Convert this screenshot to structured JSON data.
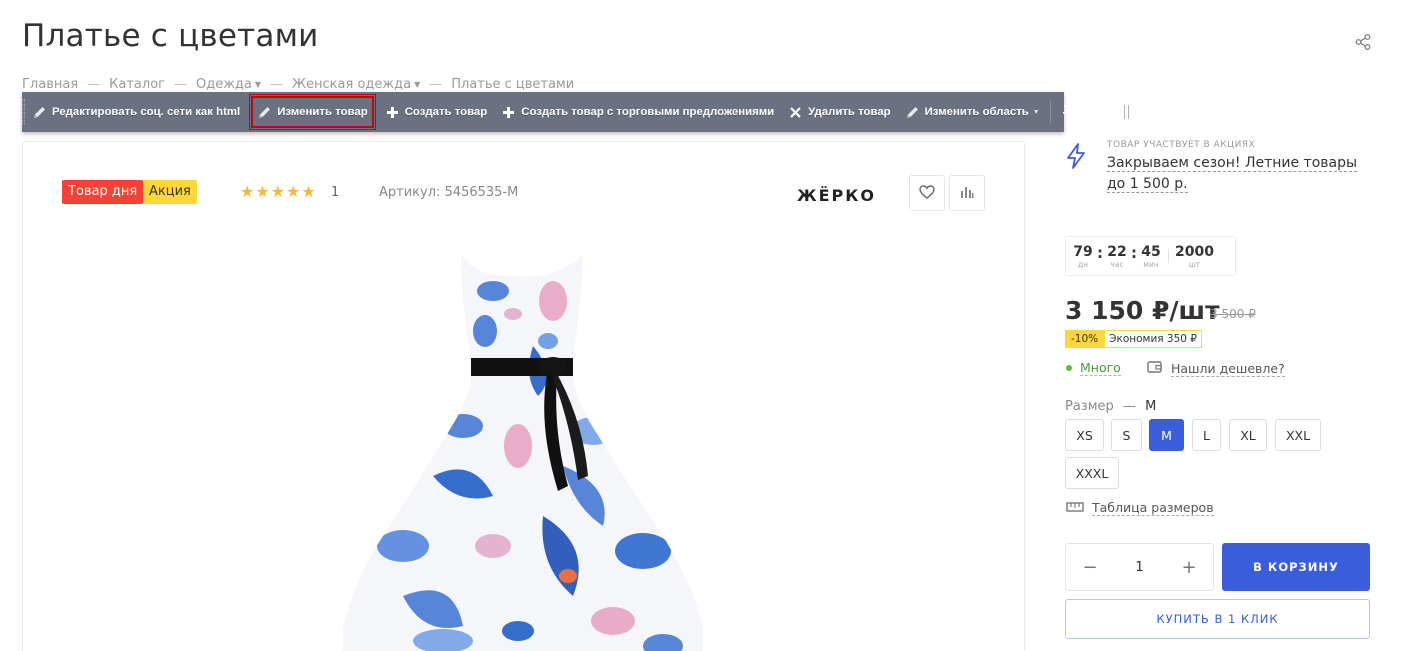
{
  "page": {
    "title": "Платье с цветами"
  },
  "breadcrumb": [
    "Главная",
    "Каталог",
    "Одежда",
    "Женская одежда",
    "Платье с цветами"
  ],
  "admin_toolbar": {
    "items": [
      {
        "label": "Редактировать соц. сети как html",
        "icon": "pencil-icon"
      },
      {
        "label": "Изменить товар",
        "icon": "pencil-icon",
        "highlighted": true
      },
      {
        "label": "Создать товар",
        "icon": "plus-icon"
      },
      {
        "label": "Создать товар с торговыми предложениями",
        "icon": "plus-icon"
      },
      {
        "label": "Удалить товар",
        "icon": "close-icon"
      },
      {
        "label": "Изменить область",
        "icon": "pencil-icon",
        "dropdown": true
      }
    ]
  },
  "product": {
    "badges": [
      "Товар дня",
      "Акция"
    ],
    "rating_stars": "★★★★★",
    "rating_count": "1",
    "sku": "Артикул: 5456535-M",
    "brand": "ЖЁРКО"
  },
  "promo": {
    "caption": "Товар участвует в акциях",
    "link": "Закрываем сезон! Летние товары до 1 500 р."
  },
  "timer": {
    "days": "79",
    "days_unit": "дн",
    "hours": "22",
    "hours_unit": "час",
    "minutes": "45",
    "minutes_unit": "мин",
    "quantity": "2000",
    "quantity_unit": "шт"
  },
  "price": {
    "current": "3 150 ₽/шт",
    "old": "3 500 ₽",
    "discount_pct": "-10%",
    "economy": "Экономия 350 ₽"
  },
  "stock": {
    "status": "Много",
    "cheaper_link": "Нашли дешевле?"
  },
  "size": {
    "label": "Размер",
    "dash": "—",
    "selected": "M",
    "options": [
      "XS",
      "S",
      "M",
      "L",
      "XL",
      "XXL",
      "XXXL"
    ],
    "table_link": "Таблица размеров"
  },
  "buy": {
    "minus": "−",
    "quantity": "1",
    "plus": "+",
    "cart_label": "В КОРЗИНУ",
    "oneclick_label": "КУПИТЬ В 1 КЛИК"
  },
  "colors": {
    "accent": "#3a5ddb",
    "sale_badge": "#ffd738",
    "day_badge": "#f44336",
    "toolbar": "#6b7181",
    "in_stock": "#68b638"
  }
}
